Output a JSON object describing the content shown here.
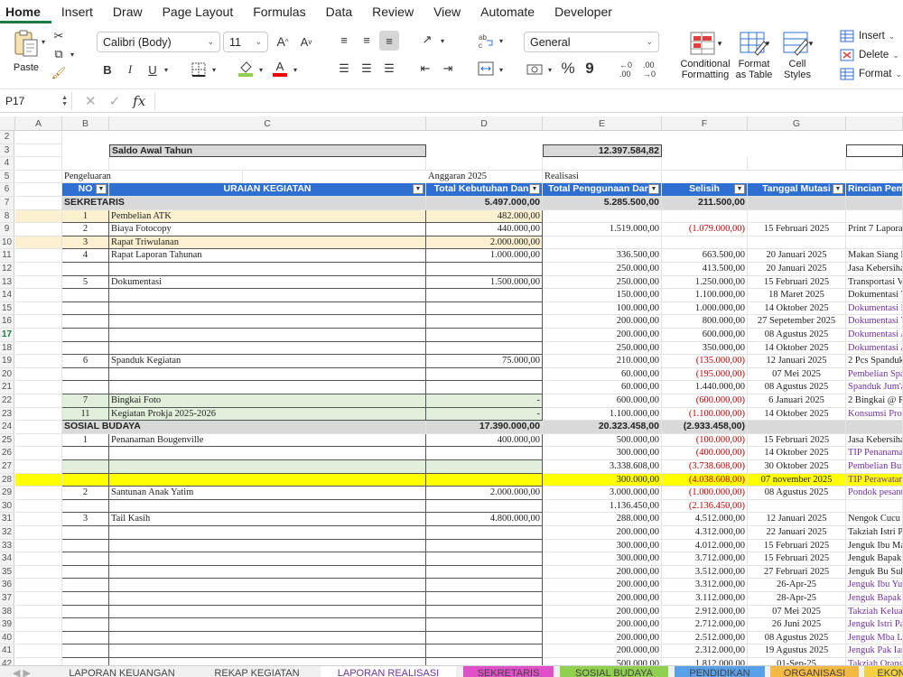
{
  "menu": [
    "Home",
    "Insert",
    "Draw",
    "Page Layout",
    "Formulas",
    "Data",
    "Review",
    "View",
    "Automate",
    "Developer"
  ],
  "ribbon": {
    "paste": "Paste",
    "font_name": "Calibri (Body)",
    "font_size": "11",
    "number_format": "General",
    "conditional_formatting": [
      "Conditional",
      "Formatting"
    ],
    "format_as_table": [
      "Format",
      "as Table"
    ],
    "cell_styles": [
      "Cell",
      "Styles"
    ],
    "insert": "Insert",
    "delete": "Delete",
    "format": "Format",
    "bold": "B",
    "italic": "I",
    "underline": "U",
    "font_color_letter": "A",
    "percent": "%",
    "comma": "9"
  },
  "formula_bar": {
    "cell_ref": "P17",
    "fx": "fx",
    "formula": ""
  },
  "columns": [
    "A",
    "B",
    "C",
    "D",
    "E",
    "F",
    "G"
  ],
  "row_numbers": [
    2,
    3,
    4,
    5,
    6,
    7,
    8,
    9,
    10,
    11,
    12,
    13,
    14,
    15,
    16,
    17,
    18,
    19,
    20,
    21,
    22,
    23,
    24,
    25,
    26,
    27,
    28,
    29,
    30,
    31,
    32,
    33,
    34,
    35,
    36,
    37,
    38,
    39,
    40,
    41,
    42
  ],
  "sheet": {
    "saldo_label": "Saldo Awal Tahun",
    "saldo_value": "12.397.584,82",
    "pengeluaran": "Pengeluaran",
    "anggaran": "Anggaran 2025",
    "realisasi": "Realisasi",
    "headers": [
      "NO",
      "URAIAN KEGIATAN",
      "Total Kebutuhan Dana",
      "Total Penggunaan Dana",
      "Selisih",
      "Tanggal Mutasi",
      "Rincian Pembelian"
    ],
    "sekretaris": {
      "label": "SEKRETARIS",
      "d": "5.497.000,00",
      "e": "5.285.500,00",
      "f": "211.500,00"
    },
    "sosial": {
      "label": "SOSIAL BUDAYA",
      "d": "17.390.000,00",
      "e": "20.323.458,00",
      "f": "(2.933.458,00)"
    },
    "rows": [
      {
        "row": 8,
        "no": "1",
        "uraian": "Pembelian ATK",
        "d": "482.000,00",
        "e": "",
        "f": "",
        "g": "",
        "h": "",
        "bg": "tan"
      },
      {
        "row": 9,
        "no": "2",
        "uraian": "Biaya Fotocopy",
        "d": "440.000,00",
        "e": "1.519.000,00",
        "f": "(1.079.000,00)",
        "g": "15 Februari 2025",
        "h": "Print 7 Laporan"
      },
      {
        "row": 10,
        "no": "3",
        "uraian": "Rapat Triwulanan",
        "d": "2.000.000,00",
        "e": "",
        "f": "",
        "g": "",
        "h": "",
        "bg": "tan"
      },
      {
        "row": 11,
        "no": "4",
        "uraian": "Rapat Laporan Tahunan",
        "d": "1.000.000,00",
        "e": "336.500,00",
        "f": "663.500,00",
        "g": "20 Januari 2025",
        "h": " Makan Siang R"
      },
      {
        "row": 12,
        "no": "",
        "uraian": "",
        "d": "",
        "e": "250.000,00",
        "f": "413.500,00",
        "g": "20 Januari 2025",
        "h": "Jasa Kebersihan"
      },
      {
        "row": 13,
        "no": "5",
        "uraian": "Dokumentasi",
        "d": "1.500.000,00",
        "e": "250.000,00",
        "f": "1.250.000,00",
        "g": "15 Februari 2025",
        "h": "Transportasi Vi"
      },
      {
        "row": 14,
        "no": "",
        "uraian": "",
        "d": "",
        "e": "150.000,00",
        "f": "1.100.000,00",
        "g": "18 Maret 2025",
        "h": "Dokumentasi V"
      },
      {
        "row": 15,
        "no": "",
        "uraian": "",
        "d": "",
        "e": "100.000,00",
        "f": "1.000.000,00",
        "g": "14 Oktober 2025",
        "h": "Dokumentasi D",
        "hp": true
      },
      {
        "row": 16,
        "no": "",
        "uraian": "",
        "d": "",
        "e": "200.000,00",
        "f": "800.000,00",
        "g": "27 Sepetember 2025",
        "h": "Dokumentasi V",
        "hp": true
      },
      {
        "row": 17,
        "no": "",
        "uraian": "",
        "d": "",
        "e": "200.000,00",
        "f": "600.000,00",
        "g": "08 Agustus 2025",
        "h": "Dokumentasi A",
        "hp": true
      },
      {
        "row": 18,
        "no": "",
        "uraian": "",
        "d": "",
        "e": "250.000,00",
        "f": "350.000,00",
        "g": "14 Oktober 2025",
        "h": "Dokumentasi A",
        "hp": true
      },
      {
        "row": 19,
        "no": "6",
        "uraian": "Spanduk Kegiatan",
        "d": "75.000,00",
        "e": "210.000,00",
        "f": "(135.000,00)",
        "g": "12 Januari 2025",
        "h": "2 Pcs Spanduk"
      },
      {
        "row": 20,
        "no": "",
        "uraian": "",
        "d": "",
        "e": "60.000,00",
        "f": "(195.000,00)",
        "g": "07 Mei 2025",
        "h": "Pembelian Span",
        "hp": true
      },
      {
        "row": 21,
        "no": "",
        "uraian": "",
        "d": "",
        "e": "60.000,00",
        "f": "1.440.000,00",
        "g": "08 Agustus 2025",
        "h": "Spanduk Jum'at",
        "hp": true
      },
      {
        "row": 22,
        "no": "7",
        "uraian": "Bingkai Foto",
        "d": "-",
        "e": "600.000,00",
        "f": "(600.000,00)",
        "g": "6 Januari 2025",
        "h": "2 Bingkai @ R",
        "bg": "green"
      },
      {
        "row": 23,
        "no": "11",
        "uraian": "Kegiatan Prokja 2025-2026",
        "d": "-",
        "e": "1.100.000,00",
        "f": "(1.100.000,00)",
        "g": "14 Oktober 2025",
        "h": "Konsumsi Prok",
        "bg": "green",
        "hp": true
      },
      {
        "row": 25,
        "no": "1",
        "uraian": "Penanaman Bougenville",
        "d": "400.000,00",
        "e": "500.000,00",
        "f": "(100.000,00)",
        "g": "15 Februari 2025",
        "h": "Jasa Kebersihan"
      },
      {
        "row": 26,
        "no": "",
        "uraian": "",
        "d": "",
        "e": "300.000,00",
        "f": "(400.000,00)",
        "g": "14 Oktober 2025",
        "h": "TIP Penanaman",
        "hp": true
      },
      {
        "row": 27,
        "no": "",
        "uraian": "",
        "d": "",
        "e": "3.338.608,00",
        "f": "(3.738.608,00)",
        "g": "30 Oktober 2025",
        "h": "Pembelian Bun",
        "bg": "green",
        "hp": true
      },
      {
        "row": 28,
        "no": "",
        "uraian": "",
        "d": "",
        "e": "300.000,00",
        "f": "(4.038.608,00)",
        "g": "07 november 2025",
        "h": "TIP Perawatan",
        "bg": "yellow",
        "hp": true
      },
      {
        "row": 29,
        "no": "2",
        "uraian": "Santunan Anak Yatim",
        "d": "2.000.000,00",
        "e": "3.000.000,00",
        "f": "(1.000.000,00)",
        "g": "08 Agustus 2025",
        "h": "Pondok pesantr",
        "hp": true
      },
      {
        "row": 30,
        "no": "",
        "uraian": "",
        "d": "",
        "e": "1.136.450,00",
        "f": "(2.136.450,00)",
        "g": "",
        "h": ""
      },
      {
        "row": 31,
        "no": "3",
        "uraian": "Tail Kasih",
        "d": "4.800.000,00",
        "e": "288.000,00",
        "f": "4.512.000,00",
        "g": "12 Januari 2025",
        "h": "Nengok Cucu I"
      },
      {
        "row": 32,
        "no": "",
        "uraian": "",
        "d": "",
        "e": "200.000,00",
        "f": "4.312.000,00",
        "g": "22 Januari 2025",
        "h": "Takziah Istri Pa"
      },
      {
        "row": 33,
        "no": "",
        "uraian": "",
        "d": "",
        "e": "300.000,00",
        "f": "4.012.000,00",
        "g": "15 Februari 2025",
        "h": "Jenguk Ibu Ma"
      },
      {
        "row": 34,
        "no": "",
        "uraian": "",
        "d": "",
        "e": "300.000,00",
        "f": "3.712.000,00",
        "g": "15 Februari 2025",
        "h": "Jenguk Bapak A"
      },
      {
        "row": 35,
        "no": "",
        "uraian": "",
        "d": "",
        "e": "200.000,00",
        "f": "3.512.000,00",
        "g": "27 Februari 2025",
        "h": "Jenguk Bu Suh"
      },
      {
        "row": 36,
        "no": "",
        "uraian": "",
        "d": "",
        "e": "200.000,00",
        "f": "3.312.000,00",
        "g": "26-Apr-25",
        "h": "Jenguk Ibu Yuy",
        "hp": true
      },
      {
        "row": 37,
        "no": "",
        "uraian": "",
        "d": "",
        "e": "200.000,00",
        "f": "3.112.000,00",
        "g": "28-Apr-25",
        "h": "Jenguk Bapak O",
        "hp": true
      },
      {
        "row": 38,
        "no": "",
        "uraian": "",
        "d": "",
        "e": "200.000,00",
        "f": "2.912.000,00",
        "g": "07 Mei 2025",
        "h": "Takziah Keluar",
        "hp": true
      },
      {
        "row": 39,
        "no": "",
        "uraian": "",
        "d": "",
        "e": "200.000,00",
        "f": "2.712.000,00",
        "g": "26 Juni 2025",
        "h": "Jenguk Istri Pa",
        "hp": true
      },
      {
        "row": 40,
        "no": "",
        "uraian": "",
        "d": "",
        "e": "200.000,00",
        "f": "2.512.000,00",
        "g": "08 Agustus 2025",
        "h": "Jenguk Mba Li",
        "hp": true
      },
      {
        "row": 41,
        "no": "",
        "uraian": "",
        "d": "",
        "e": "200.000,00",
        "f": "2.312.000,00",
        "g": "19 Agustus 2025",
        "h": "Jenguk Pak Ian",
        "hp": true
      },
      {
        "row": 42,
        "no": "",
        "uraian": "",
        "d": "",
        "e": "500.000,00",
        "f": "1.812.000,00",
        "g": "01-Sep-25",
        "h": "Takziah Orang",
        "hp": true
      }
    ]
  },
  "tabs": [
    {
      "label": "LAPORAN KEUANGAN",
      "color": "#f0f0f0",
      "active": false
    },
    {
      "label": "REKAP KEGIATAN",
      "color": "#f0f0f0",
      "active": false
    },
    {
      "label": "LAPORAN REALISASI",
      "color": "#ffffff",
      "active": true
    },
    {
      "label": "SEKRETARIS",
      "color": "#e050c8",
      "active": false
    },
    {
      "label": "SOSIAL BUDAYA",
      "color": "#8fd14f",
      "active": false
    },
    {
      "label": "PENDIDIKAN",
      "color": "#5aa0e8",
      "active": false
    },
    {
      "label": "ORGANISASI",
      "color": "#f4b942",
      "active": false
    },
    {
      "label": "EKON",
      "color": "#f4d03f",
      "active": false
    }
  ]
}
